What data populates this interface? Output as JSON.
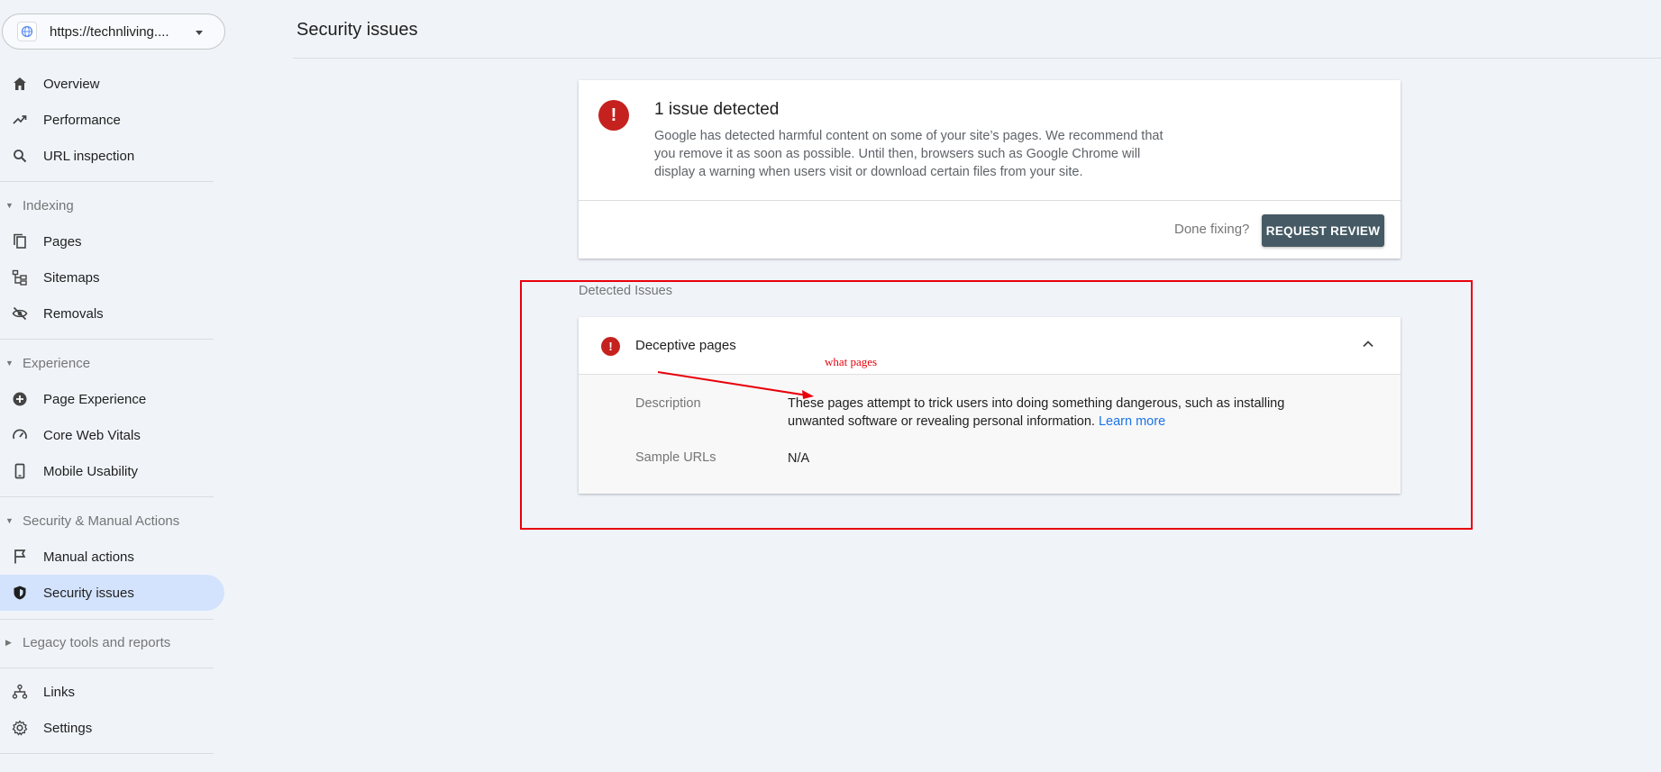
{
  "sidebar": {
    "property": {
      "url": "https://technliving...."
    },
    "items_top": [
      {
        "label": "Overview",
        "icon": "home-icon"
      },
      {
        "label": "Performance",
        "icon": "trending-up-icon"
      },
      {
        "label": "URL inspection",
        "icon": "search-icon"
      }
    ],
    "indexing": {
      "label": "Indexing",
      "items": [
        {
          "label": "Pages",
          "icon": "pages-icon"
        },
        {
          "label": "Sitemaps",
          "icon": "sitemap-icon"
        },
        {
          "label": "Removals",
          "icon": "eye-off-icon"
        }
      ]
    },
    "experience": {
      "label": "Experience",
      "items": [
        {
          "label": "Page Experience",
          "icon": "plus-circle-icon"
        },
        {
          "label": "Core Web Vitals",
          "icon": "gauge-icon"
        },
        {
          "label": "Mobile Usability",
          "icon": "phone-icon"
        }
      ]
    },
    "security": {
      "label": "Security & Manual Actions",
      "items": [
        {
          "label": "Manual actions",
          "icon": "flag-icon"
        },
        {
          "label": "Security issues",
          "icon": "shield-icon"
        }
      ]
    },
    "legacy": {
      "label": "Legacy tools and reports"
    },
    "items_bottom": [
      {
        "label": "Links",
        "icon": "links-icon"
      },
      {
        "label": "Settings",
        "icon": "gear-icon"
      }
    ]
  },
  "header": {
    "title": "Security issues"
  },
  "summary": {
    "title": "1 issue detected",
    "body": "Google has detected harmful content on some of your site’s pages. We recommend that you remove it as soon as possible. Until then, browsers such as Google Chrome will display a warning when users visit or download certain files from your site.",
    "done_fixing": "Done fixing?",
    "request_review": "REQUEST REVIEW"
  },
  "detected": {
    "section_label": "Detected Issues",
    "issue": {
      "name": "Deceptive pages",
      "description_label": "Description",
      "description_text": "These pages attempt to trick users into doing something dangerous, such as installing unwanted software or revealing personal information.",
      "learn_more": "Learn more",
      "sample_urls_label": "Sample URLs",
      "sample_urls_value": "N/A"
    }
  },
  "annotation": {
    "text": "what pages",
    "color": "#e8000b"
  },
  "colors": {
    "accent": "#1a73e8",
    "error": "#c5221f",
    "active_nav": "#d3e3fd",
    "button": "#455a64"
  }
}
